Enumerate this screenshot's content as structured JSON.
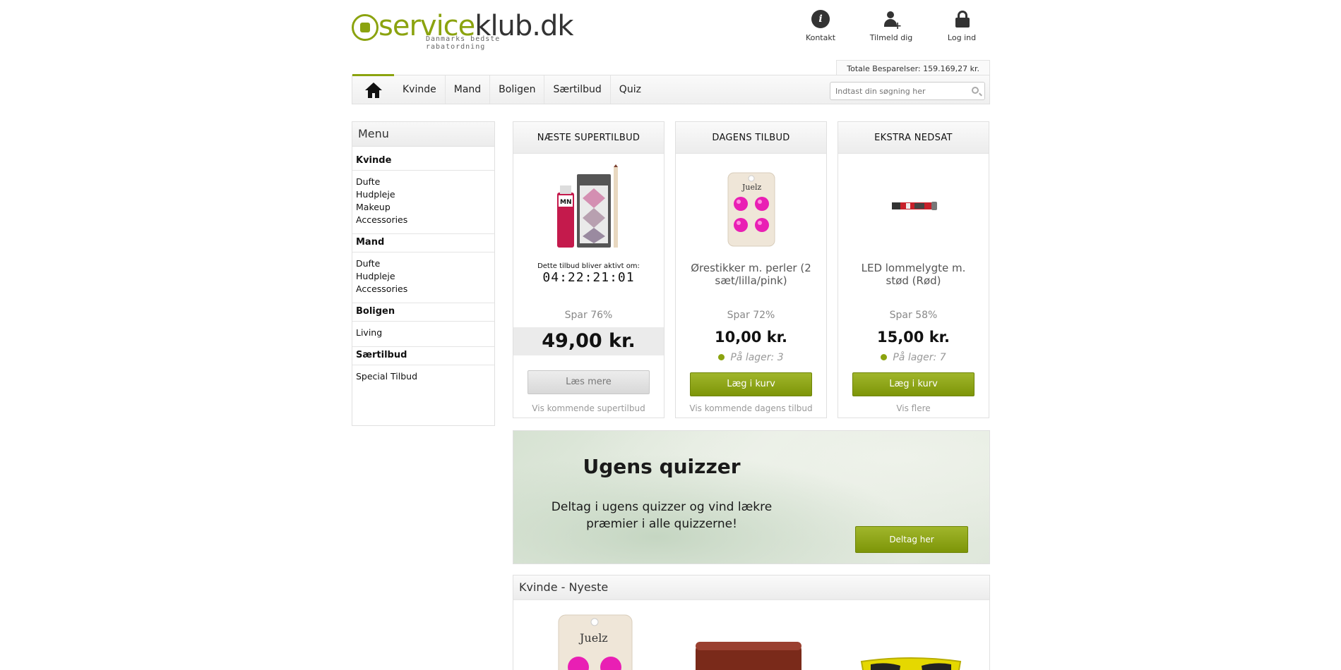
{
  "header": {
    "logo_part1": "service",
    "logo_part2": "klub.dk",
    "tagline": "Danmarks bedste rabatordning",
    "links": [
      {
        "label": "Kontakt",
        "icon": "info-icon"
      },
      {
        "label": "Tilmeld dig",
        "icon": "user-add-icon"
      },
      {
        "label": "Log ind",
        "icon": "lock-icon"
      }
    ],
    "savings": "Totale Besparelser: 159.169,27 kr."
  },
  "nav": {
    "items": [
      "Kvinde",
      "Mand",
      "Boligen",
      "Særtilbud",
      "Quiz"
    ],
    "search_placeholder": "Indtast din søgning her"
  },
  "sidebar": {
    "title": "Menu",
    "groups": [
      {
        "title": "Kvinde",
        "links": [
          "Dufte",
          "Hudpleje",
          "Makeup",
          "Accessories"
        ]
      },
      {
        "title": "Mand",
        "links": [
          "Dufte",
          "Hudpleje",
          "Accessories"
        ]
      },
      {
        "title": "Boligen",
        "links": [
          "Living"
        ]
      },
      {
        "title": "Særtilbud",
        "links": [
          "Special Tilbud"
        ]
      }
    ]
  },
  "offers": [
    {
      "heading": "NÆSTE SUPERTILBUD",
      "timer_label": "Dette tilbud bliver aktivt om:",
      "timer": "04:22:21:01",
      "spar": "Spar 76%",
      "price": "49,00 kr.",
      "button": "Læs mere",
      "link": "Vis kommende supertilbud"
    },
    {
      "heading": "DAGENS TILBUD",
      "name": "Ørestikker m. perler (2 sæt/lilla/pink)",
      "spar": "Spar 72%",
      "price": "10,00 kr.",
      "stock": "På lager: 3",
      "button": "Læg i kurv",
      "link": "Vis kommende dagens tilbud"
    },
    {
      "heading": "EKSTRA NEDSAT",
      "name": "LED lommelygte m. stød (Rød)",
      "spar": "Spar 58%",
      "price": "15,00 kr.",
      "stock": "På lager: 7",
      "button": "Læg i kurv",
      "link": "Vis flere"
    }
  ],
  "quiz": {
    "title": "Ugens quizzer",
    "text": "Deltag i ugens quizzer og vind lækre præmier i alle quizzerne!",
    "button": "Deltag her"
  },
  "newest": {
    "title": "Kvinde - Nyeste"
  },
  "colors": {
    "accent": "#8ba30f",
    "button_green": "#7d9508",
    "earring_pink": "#e91fb4"
  }
}
